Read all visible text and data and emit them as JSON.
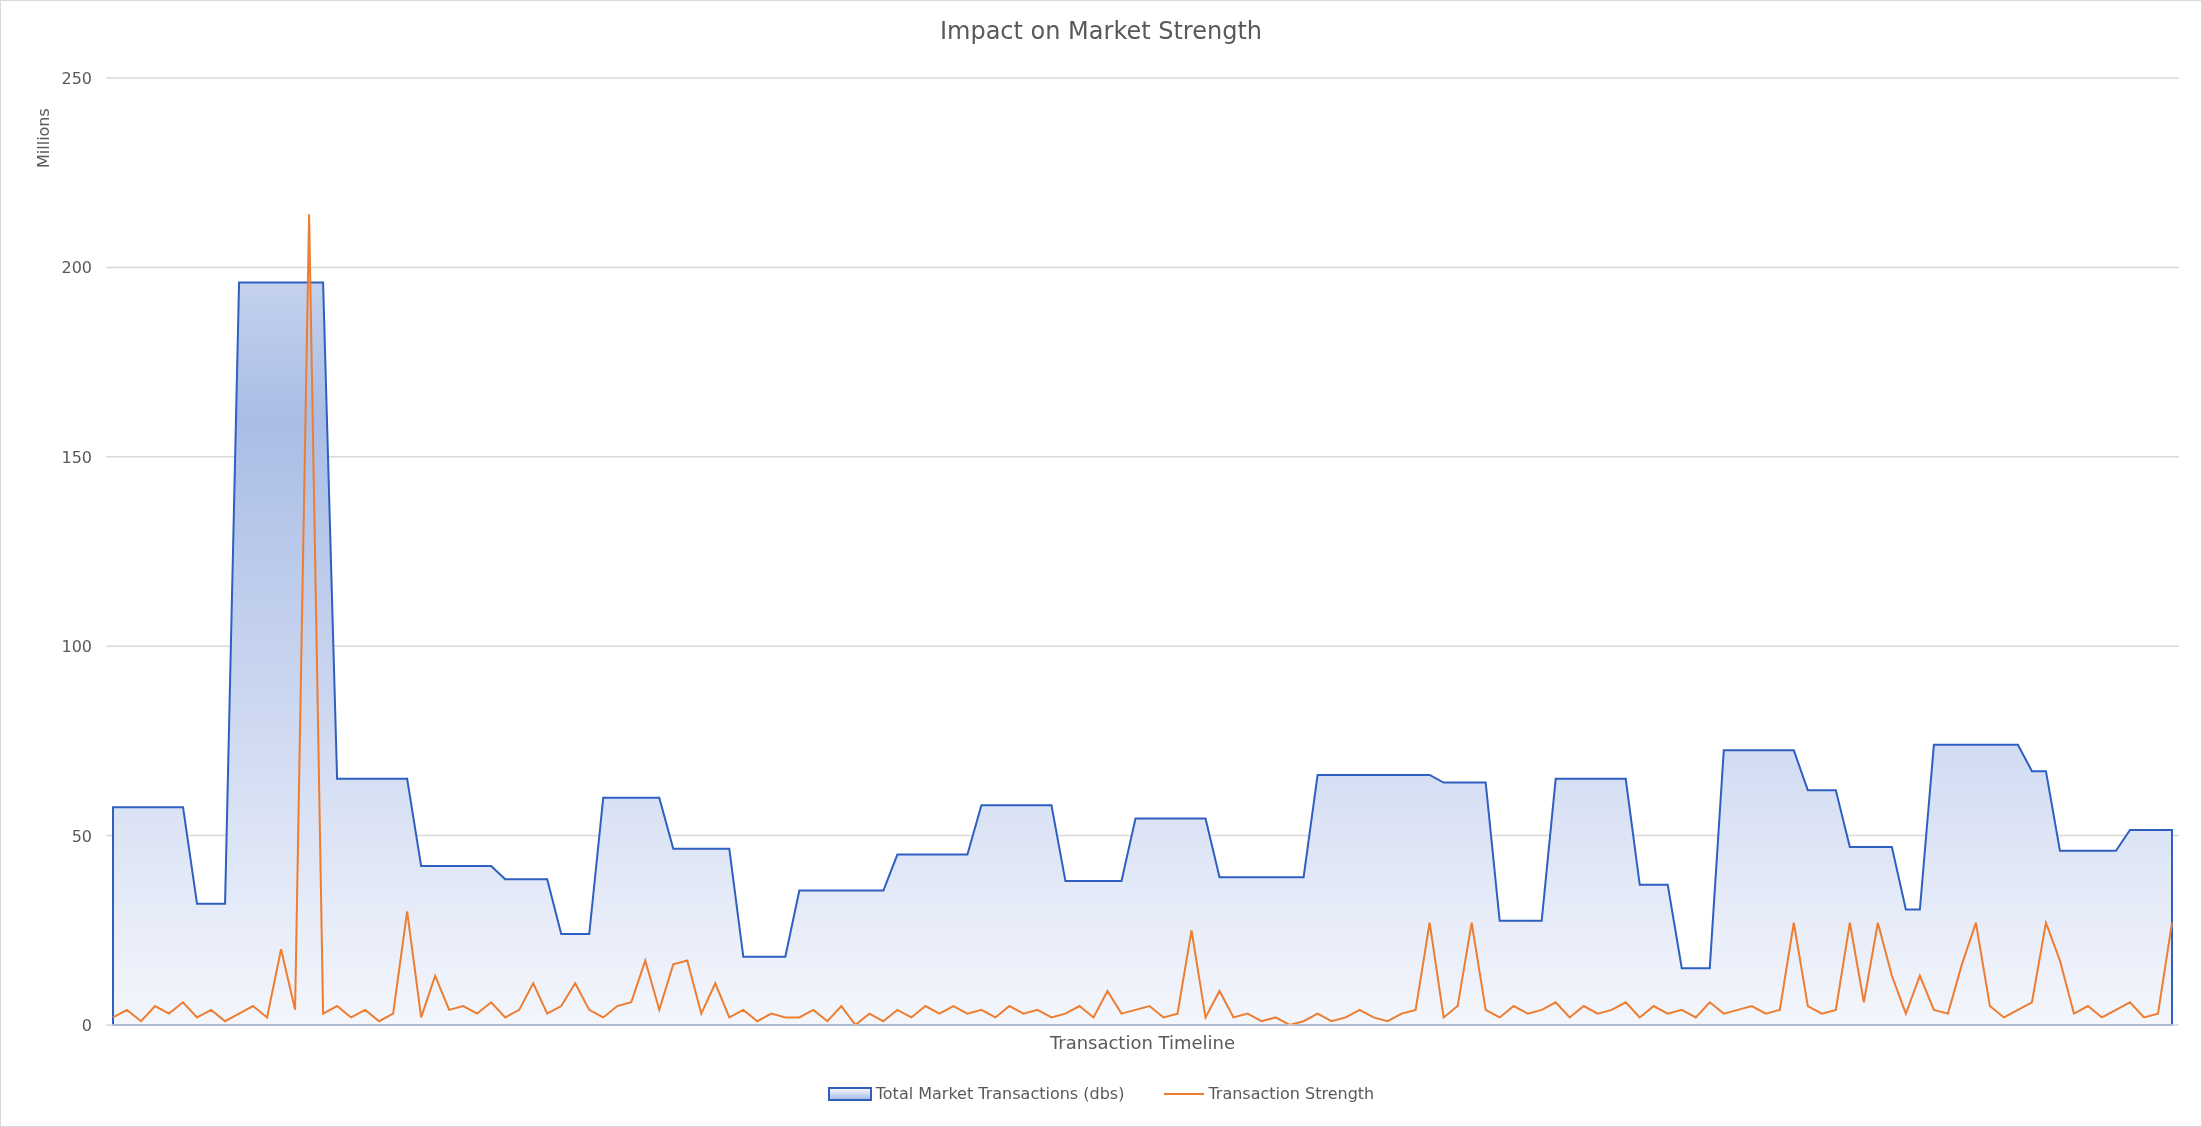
{
  "chart": {
    "chart_data": {
      "type": "area",
      "title": "Impact on Market Strength",
      "xlabel": "Transaction Timeline",
      "ylabel": "Millions",
      "categories": [
        null,
        null,
        null,
        null,
        null,
        null,
        null,
        null,
        null,
        null,
        null,
        null,
        null,
        null,
        null,
        null,
        null,
        null,
        null,
        null,
        null,
        null,
        null,
        null,
        null,
        null,
        null,
        null,
        null,
        null,
        null,
        null,
        null,
        null,
        null,
        null,
        null,
        null,
        null,
        null,
        null,
        null,
        null,
        null,
        null,
        null,
        null,
        null,
        null,
        null,
        null,
        null,
        null,
        null,
        null,
        null,
        null,
        null,
        null,
        null,
        null,
        null,
        null,
        null,
        null,
        null,
        null,
        null,
        null,
        null,
        null,
        null,
        null,
        null,
        null,
        null,
        null,
        null,
        null,
        null,
        null,
        null,
        null,
        null,
        null,
        null,
        null,
        null,
        null,
        null,
        null,
        null,
        null,
        null,
        null,
        null,
        null,
        null,
        null,
        null,
        null,
        null,
        null,
        null,
        null,
        null,
        null,
        null,
        null,
        null,
        null,
        null,
        null,
        null,
        null,
        null,
        null,
        null,
        null,
        null,
        null,
        null,
        null,
        null,
        null,
        null,
        null,
        null,
        null,
        null,
        null,
        null,
        null,
        null,
        null,
        null,
        null,
        null,
        null,
        null,
        null,
        null,
        null,
        null,
        null,
        null,
        null,
        null
      ],
      "grid": true,
      "ylim": [
        0,
        250
      ],
      "yticks": [
        0,
        50,
        100,
        150,
        200,
        250
      ],
      "series": [
        {
          "name": "Total Market Transactions (dbs)",
          "color": "#2e5fc1",
          "values": [
            57.5,
            57.5,
            57.5,
            57.5,
            57.5,
            57.5,
            32,
            32,
            32,
            196,
            196,
            196,
            196,
            196,
            196,
            196,
            65,
            65,
            65,
            65,
            65,
            65,
            42,
            42,
            42,
            42,
            42,
            42,
            38.5,
            38.5,
            38.5,
            38.5,
            24,
            24,
            24,
            60,
            60,
            60,
            60,
            60,
            46.5,
            46.5,
            46.5,
            46.5,
            46.5,
            18,
            18,
            18,
            18,
            35.5,
            35.5,
            35.5,
            35.5,
            35.5,
            35.5,
            35.5,
            45,
            45,
            45,
            45,
            45,
            45,
            58,
            58,
            58,
            58,
            58,
            58,
            38,
            38,
            38,
            38,
            38,
            54.5,
            54.5,
            54.5,
            54.5,
            54.5,
            54.5,
            39,
            39,
            39,
            39,
            39,
            39,
            39,
            66,
            66,
            66,
            66,
            66,
            66,
            66,
            66,
            66,
            64,
            64,
            64,
            64,
            27.5,
            27.5,
            27.5,
            27.5,
            65,
            65,
            65,
            65,
            65,
            65,
            37,
            37,
            37,
            15,
            15,
            15,
            72.5,
            72.5,
            72.5,
            72.5,
            72.5,
            72.5,
            62,
            62,
            62,
            47,
            47,
            47,
            47,
            30.5,
            30.5,
            74,
            74,
            74,
            74,
            74,
            74,
            74,
            67,
            67,
            46,
            46,
            46,
            46,
            46,
            51.5,
            51.5,
            51.5,
            51.5
          ]
        },
        {
          "name": "Transaction Strength",
          "type": "line",
          "color": "#ed7d31",
          "values": [
            2,
            4,
            1,
            5,
            3,
            6,
            2,
            4,
            1,
            3,
            5,
            2,
            20,
            4,
            214,
            3,
            5,
            2,
            4,
            1,
            3,
            30,
            2,
            13,
            4,
            5,
            3,
            6,
            2,
            4,
            11,
            3,
            5,
            11,
            4,
            2,
            5,
            6,
            17,
            4,
            16,
            17,
            3,
            11,
            2,
            4,
            1,
            3,
            2,
            2,
            4,
            1,
            5,
            0,
            3,
            1,
            4,
            2,
            5,
            3,
            5,
            3,
            4,
            2,
            5,
            3,
            4,
            2,
            3,
            5,
            2,
            9,
            3,
            4,
            5,
            2,
            3,
            25,
            2,
            9,
            2,
            3,
            1,
            2,
            0,
            1,
            3,
            1,
            2,
            4,
            2,
            1,
            3,
            4,
            27,
            2,
            5,
            27,
            4,
            2,
            5,
            3,
            4,
            6,
            2,
            5,
            3,
            4,
            6,
            2,
            5,
            3,
            4,
            2,
            6,
            3,
            4,
            5,
            3,
            4,
            27,
            5,
            3,
            4,
            27,
            6,
            27,
            13,
            3,
            13,
            4,
            3,
            16,
            27,
            5,
            2,
            4,
            6,
            27,
            17,
            3,
            5,
            2,
            4,
            6,
            2,
            3,
            27
          ]
        }
      ]
    }
  }
}
